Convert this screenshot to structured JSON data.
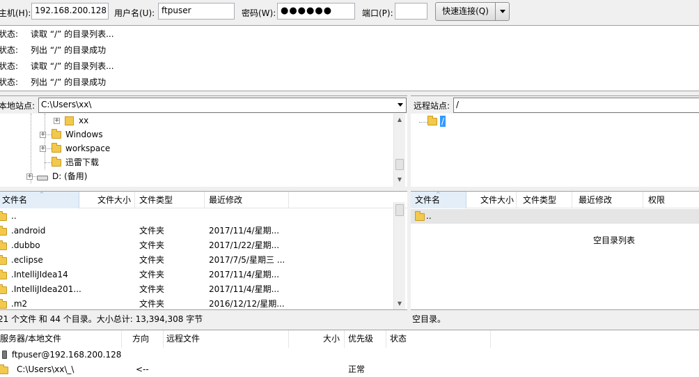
{
  "quickconnect": {
    "host_label": "主机(H):",
    "host_value": "192.168.200.128",
    "user_label": "用户名(U):",
    "user_value": "ftpuser",
    "pass_label": "密码(W):",
    "pass_value": "●●●●●●",
    "port_label": "端口(P):",
    "port_value": "",
    "connect_label": "快速连接(Q)"
  },
  "log": [
    {
      "key": "状态:",
      "text": "读取 “/” 的目录列表..."
    },
    {
      "key": "状态:",
      "text": "列出 “/” 的目录成功"
    },
    {
      "key": "状态:",
      "text": "读取 “/” 的目录列表..."
    },
    {
      "key": "状态:",
      "text": "列出 “/” 的目录成功"
    }
  ],
  "local": {
    "site_label": "本地站点:",
    "path": "C:\\Users\\xx\\",
    "tree": [
      "xx",
      "Windows",
      "workspace",
      "迅雷下载",
      "D: (备用)"
    ],
    "columns": [
      "文件名",
      "文件大小",
      "文件类型",
      "最近修改"
    ],
    "files": [
      {
        "name": "..",
        "type": "",
        "modified": ""
      },
      {
        "name": ".android",
        "type": "文件夹",
        "modified": "2017/11/4/星期..."
      },
      {
        "name": ".dubbo",
        "type": "文件夹",
        "modified": "2017/1/22/星期..."
      },
      {
        "name": ".eclipse",
        "type": "文件夹",
        "modified": "2017/7/5/星期三 ..."
      },
      {
        "name": ".IntelliJIdea14",
        "type": "文件夹",
        "modified": "2017/11/4/星期..."
      },
      {
        "name": ".IntelliJIdea201...",
        "type": "文件夹",
        "modified": "2017/11/4/星期..."
      },
      {
        "name": ".m2",
        "type": "文件夹",
        "modified": "2016/12/12/星期..."
      }
    ],
    "status": "21 个文件 和 44 个目录。大小总计: 13,394,308 字节"
  },
  "remote": {
    "site_label": "远程站点:",
    "path": "/",
    "tree_root": "/",
    "columns": [
      "文件名",
      "文件大小",
      "文件类型",
      "最近修改",
      "权限"
    ],
    "files": [
      {
        "name": ".."
      }
    ],
    "empty_text": "空目录列表",
    "status": "空目录。"
  },
  "queue": {
    "columns": [
      "服务器/本地文件",
      "方向",
      "远程文件",
      "大小",
      "优先级",
      "状态"
    ],
    "server": "ftpuser@192.168.200.128",
    "item": {
      "local": "C:\\Users\\xx\\_\\",
      "direction": "<--",
      "priority": "正常"
    }
  }
}
